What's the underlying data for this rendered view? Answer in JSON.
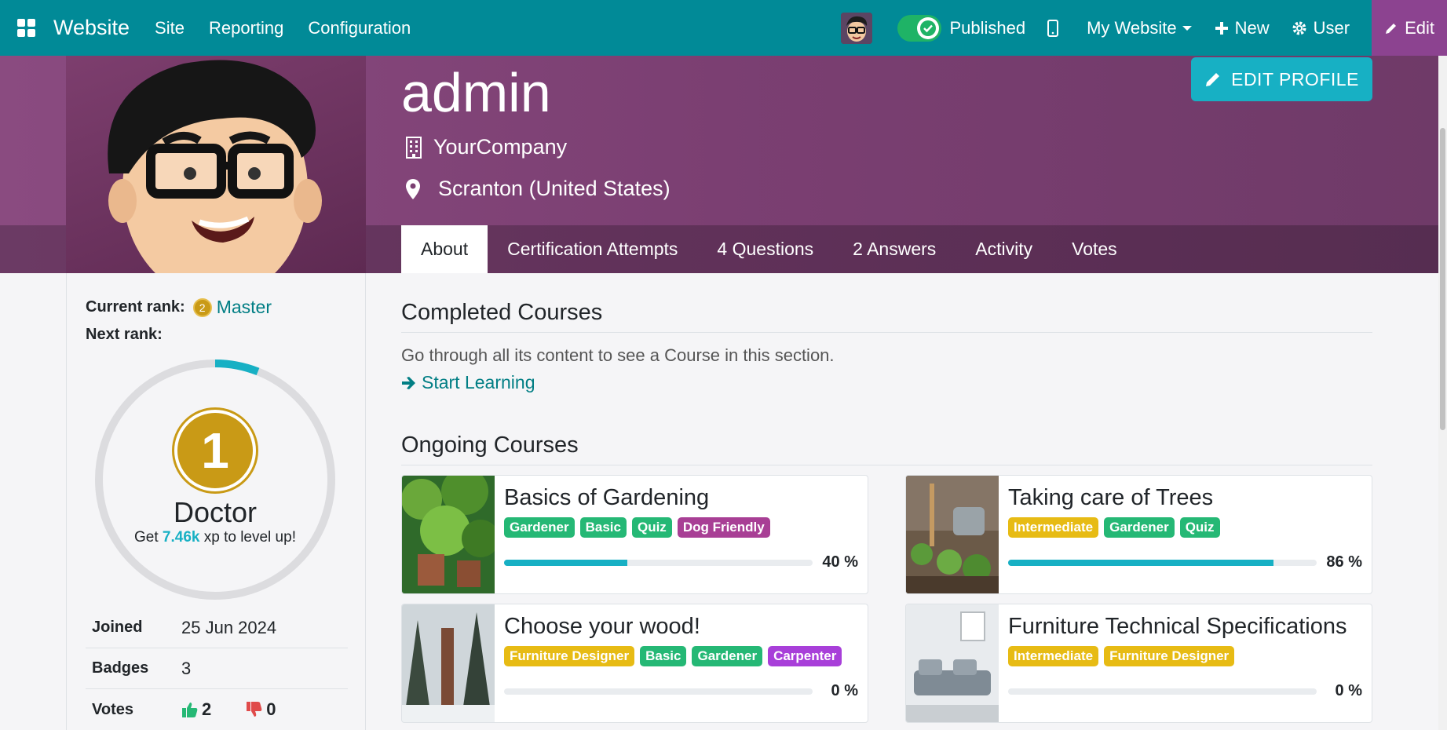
{
  "navbar": {
    "brand": "Website",
    "menu": [
      "Site",
      "Reporting",
      "Configuration"
    ],
    "published_label": "Published",
    "website_selector": "My Website",
    "new_label": "New",
    "user_label": "User",
    "edit_label": "Edit"
  },
  "profile": {
    "name": "admin",
    "company": "YourCompany",
    "location": "Scranton (United States)",
    "edit_profile_label": "EDIT PROFILE",
    "tabs": [
      "About",
      "Certification Attempts",
      "4 Questions",
      "2 Answers",
      "Activity",
      "Votes"
    ],
    "active_tab": "About"
  },
  "sidebar": {
    "current_rank_label": "Current rank:",
    "current_rank_number": "2",
    "current_rank_value": "Master",
    "next_rank_label": "Next rank:",
    "next_rank_number": "1",
    "next_rank_name": "Doctor",
    "xp_prefix": "Get",
    "xp_value": "7.46k",
    "xp_suffix": "xp to level up!",
    "progress_fraction": 0.06,
    "stats": {
      "joined_label": "Joined",
      "joined_value": "25 Jun 2024",
      "badges_label": "Badges",
      "badges_value": "3",
      "votes_label": "Votes",
      "votes_up": "2",
      "votes_down": "0"
    }
  },
  "main": {
    "completed_title": "Completed Courses",
    "completed_empty": "Go through all its content to see a Course in this section.",
    "start_learning": "Start Learning",
    "ongoing_title": "Ongoing Courses",
    "courses": [
      {
        "title": "Basics of Gardening",
        "tags": [
          "Gardener",
          "Basic",
          "Quiz",
          "Dog Friendly"
        ],
        "progress": 40,
        "pct": "40 %"
      },
      {
        "title": "Taking care of Trees",
        "tags": [
          "Intermediate",
          "Gardener",
          "Quiz"
        ],
        "progress": 86,
        "pct": "86 %"
      },
      {
        "title": "Choose your wood!",
        "tags": [
          "Furniture Designer",
          "Basic",
          "Gardener",
          "Carpenter"
        ],
        "progress": 0,
        "pct": "0 %"
      },
      {
        "title": "Furniture Technical Specifications",
        "tags": [
          "Intermediate",
          "Furniture Designer"
        ],
        "progress": 0,
        "pct": "0 %"
      }
    ]
  },
  "colors": {
    "navbar": "#018a97",
    "edit": "#8c4390",
    "accent": "#17b0c4",
    "tag_green": "#25b875",
    "tag_yellow": "#e7bb14",
    "tag_purple": "#a83f95",
    "tag_violet": "#a83fd9"
  }
}
